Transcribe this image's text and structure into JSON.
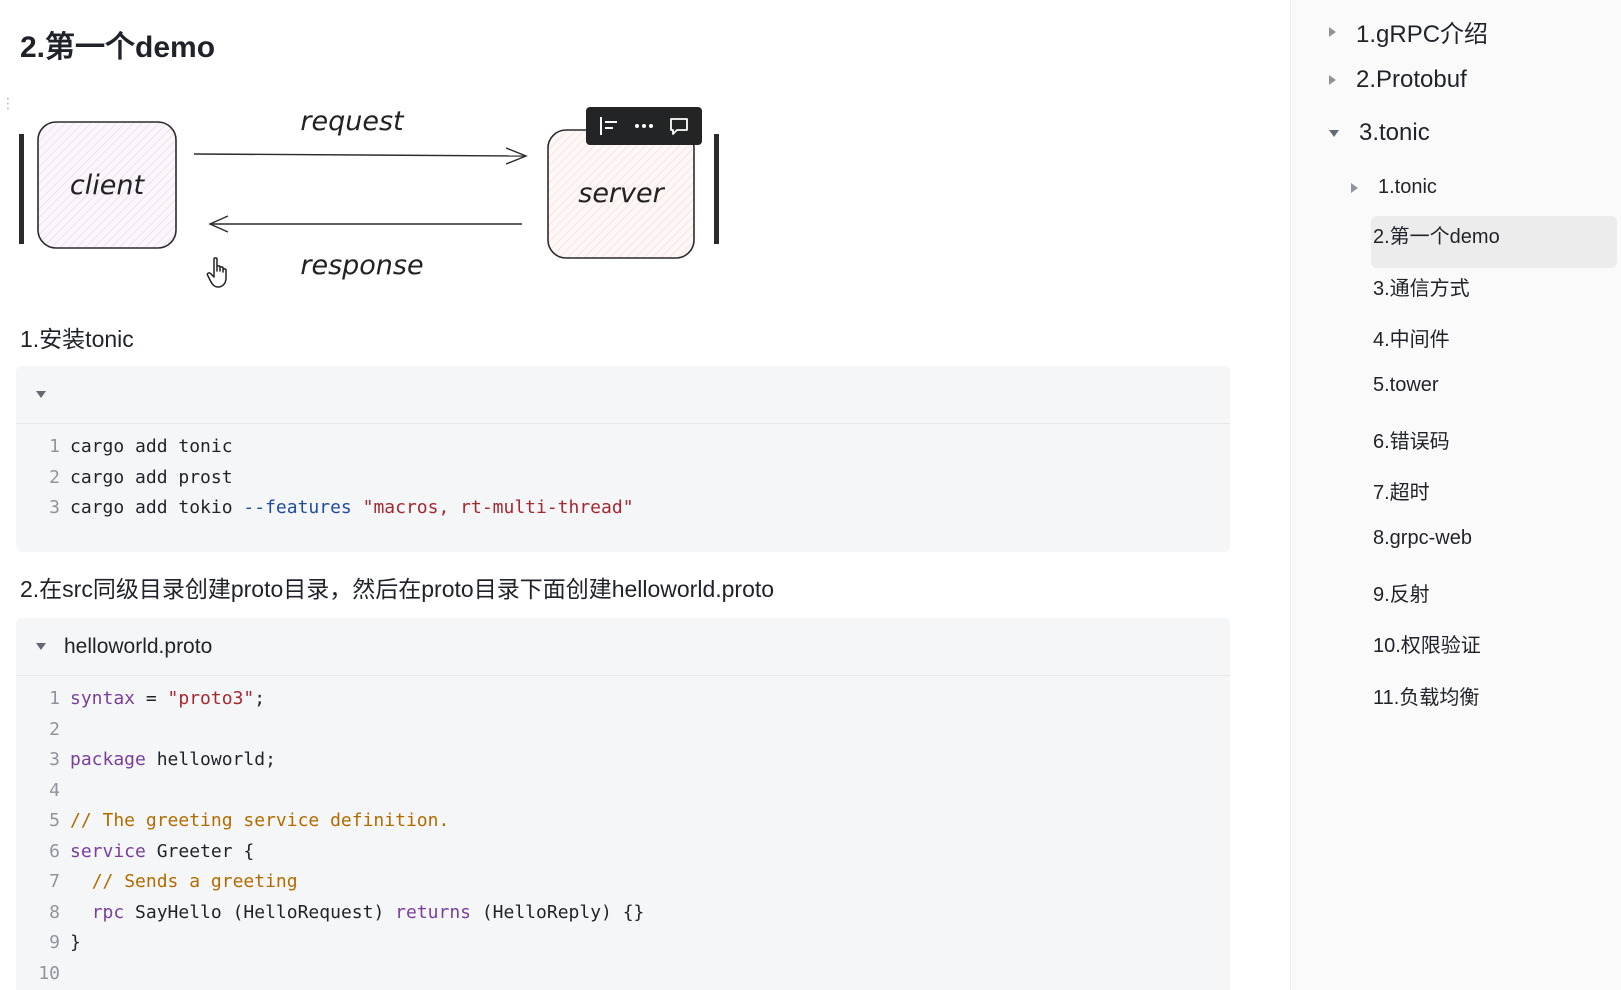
{
  "page": {
    "title": "2.第一个demo"
  },
  "diagram": {
    "client_label": "client",
    "server_label": "server",
    "request_label": "request",
    "response_label": "response"
  },
  "float_toolbar": {
    "icons": [
      "align-icon",
      "more-icon",
      "comment-icon"
    ]
  },
  "section1": {
    "heading": "1.安装tonic",
    "filename": "",
    "lines": [
      {
        "n": "1",
        "tokens": [
          {
            "t": "cargo add tonic",
            "c": "plain"
          }
        ]
      },
      {
        "n": "2",
        "tokens": [
          {
            "t": "cargo add prost",
            "c": "plain"
          }
        ]
      },
      {
        "n": "3",
        "tokens": [
          {
            "t": "cargo add tokio ",
            "c": "plain"
          },
          {
            "t": "--features",
            "c": "flag"
          },
          {
            "t": " ",
            "c": "plain"
          },
          {
            "t": "\"macros, rt-multi-thread\"",
            "c": "str"
          }
        ]
      }
    ]
  },
  "section2": {
    "heading": "2.在src同级目录创建proto目录，然后在proto目录下面创建helloworld.proto",
    "filename": "helloworld.proto",
    "lines": [
      {
        "n": "1",
        "tokens": [
          {
            "t": "syntax",
            "c": "kw"
          },
          {
            "t": " = ",
            "c": "plain"
          },
          {
            "t": "\"proto3\"",
            "c": "str"
          },
          {
            "t": ";",
            "c": "plain"
          }
        ]
      },
      {
        "n": "2",
        "tokens": []
      },
      {
        "n": "3",
        "tokens": [
          {
            "t": "package",
            "c": "kw"
          },
          {
            "t": " helloworld;",
            "c": "plain"
          }
        ]
      },
      {
        "n": "4",
        "tokens": []
      },
      {
        "n": "5",
        "tokens": [
          {
            "t": "// The greeting service definition.",
            "c": "comment"
          }
        ]
      },
      {
        "n": "6",
        "tokens": [
          {
            "t": "service",
            "c": "kw"
          },
          {
            "t": " Greeter {",
            "c": "plain"
          }
        ]
      },
      {
        "n": "7",
        "tokens": [
          {
            "t": "  ",
            "c": "plain"
          },
          {
            "t": "// Sends a greeting",
            "c": "comment"
          }
        ]
      },
      {
        "n": "8",
        "tokens": [
          {
            "t": "  ",
            "c": "plain"
          },
          {
            "t": "rpc",
            "c": "kw"
          },
          {
            "t": " SayHello (HelloRequest) ",
            "c": "plain"
          },
          {
            "t": "returns",
            "c": "kw"
          },
          {
            "t": " (HelloReply) {}",
            "c": "plain"
          }
        ]
      },
      {
        "n": "9",
        "tokens": [
          {
            "t": "}",
            "c": "plain"
          }
        ]
      },
      {
        "n": "10",
        "tokens": []
      }
    ]
  },
  "toc": {
    "l1": [
      {
        "label": "1.gRPC介绍",
        "expanded": false
      },
      {
        "label": "2.Protobuf",
        "expanded": false
      },
      {
        "label": "3.tonic",
        "expanded": true
      }
    ],
    "l2": [
      {
        "label": "1.tonic",
        "expanded": false
      }
    ],
    "l3": [
      {
        "label": "2.第一个demo",
        "active": true
      },
      {
        "label": "3.通信方式"
      },
      {
        "label": "4.中间件"
      },
      {
        "label": "5.tower"
      },
      {
        "label": "6.错误码"
      },
      {
        "label": "7.超时"
      },
      {
        "label": "8.grpc-web"
      },
      {
        "label": "9.反射"
      },
      {
        "label": "10.权限验证"
      },
      {
        "label": "11.负载均衡"
      }
    ]
  }
}
